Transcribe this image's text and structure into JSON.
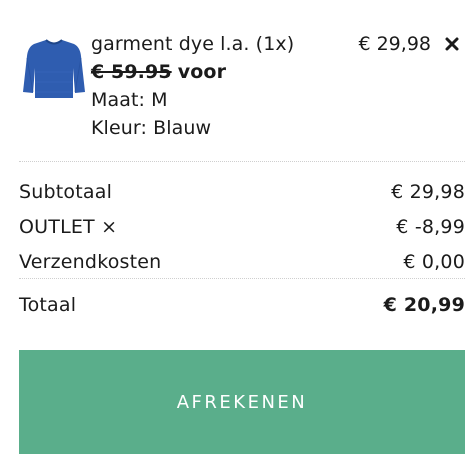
{
  "colors": {
    "accent": "#5aae8b",
    "text": "#1b1b1b",
    "product": "#2f5db0"
  },
  "item": {
    "image_icon": "blue-sweater-thumbnail",
    "name_qty": "garment dye l.a. (1x)",
    "old_price": "€ 59.95",
    "voor": "voor",
    "size": "Maat: M",
    "color": "Kleur: Blauw",
    "price": "€ 29,98",
    "remove_icon": "close-icon"
  },
  "summary": {
    "subtotal_label": "Subtotaal",
    "subtotal_value": "€ 29,98",
    "coupon_label": "OUTLET",
    "coupon_remove": "×",
    "coupon_value": "€ -8,99",
    "shipping_label": "Verzendkosten",
    "shipping_value": "€ 0,00",
    "total_label": "Totaal",
    "total_value": "€ 20,99"
  },
  "checkout": {
    "label": "AFREKENEN"
  }
}
